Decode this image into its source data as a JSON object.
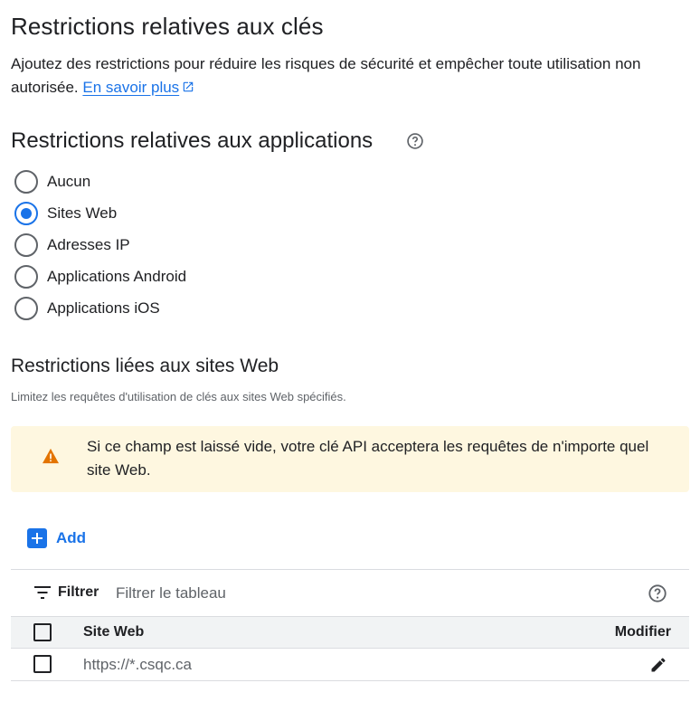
{
  "header": {
    "title": "Restrictions relatives aux clés",
    "description": "Ajoutez des restrictions pour réduire les risques de sécurité et empêcher toute utilisation non autorisée.",
    "learn_more": "En savoir plus"
  },
  "app_restrictions": {
    "title": "Restrictions relatives aux applications",
    "options": [
      {
        "label": "Aucun",
        "checked": false
      },
      {
        "label": "Sites Web",
        "checked": true
      },
      {
        "label": "Adresses IP",
        "checked": false
      },
      {
        "label": "Applications Android",
        "checked": false
      },
      {
        "label": "Applications iOS",
        "checked": false
      }
    ]
  },
  "website_restrictions": {
    "title": "Restrictions liées aux sites Web",
    "description": "Limitez les requêtes d'utilisation de clés aux sites Web spécifiés.",
    "warning": "Si ce champ est laissé vide, votre clé API acceptera les requêtes de n'importe quel site Web."
  },
  "add_button": "Add",
  "table": {
    "filter_label": "Filtrer",
    "filter_placeholder": "Filtrer le tableau",
    "columns": {
      "site": "Site Web",
      "modify": "Modifier"
    },
    "rows": [
      {
        "site": "https://*.csqc.ca"
      }
    ]
  },
  "colors": {
    "accent": "#1a73e8",
    "warning_bg": "#fef7e0",
    "warning_icon": "#e37400"
  }
}
